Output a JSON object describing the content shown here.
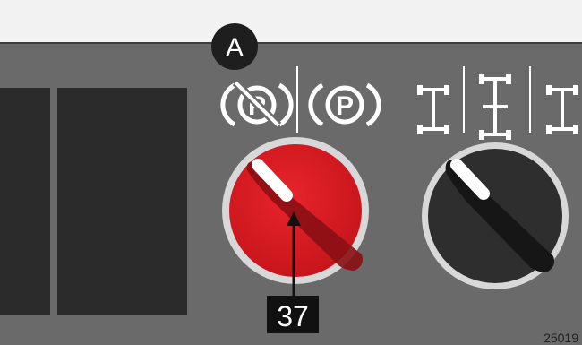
{
  "callout_a": {
    "text": "A"
  },
  "callout_37": {
    "text": "37"
  },
  "figure_code": "25019",
  "icons": {
    "parking_brake_off": "parking-brake-released-icon",
    "parking_brake_on": "parking-brake-applied-icon",
    "axle_modes": [
      "axle-mode-1-icon",
      "axle-mode-2-icon",
      "axle-mode-3-icon"
    ]
  },
  "parking_brake_on_letter": "P",
  "parking_brake_off_letter": "P",
  "colors": {
    "panel": "#6a6a6a",
    "background": "#f2f2f2",
    "brake_knob": "#d91c24",
    "axle_knob": "#2e2e2e",
    "dark_block": "#2b2b2b"
  }
}
